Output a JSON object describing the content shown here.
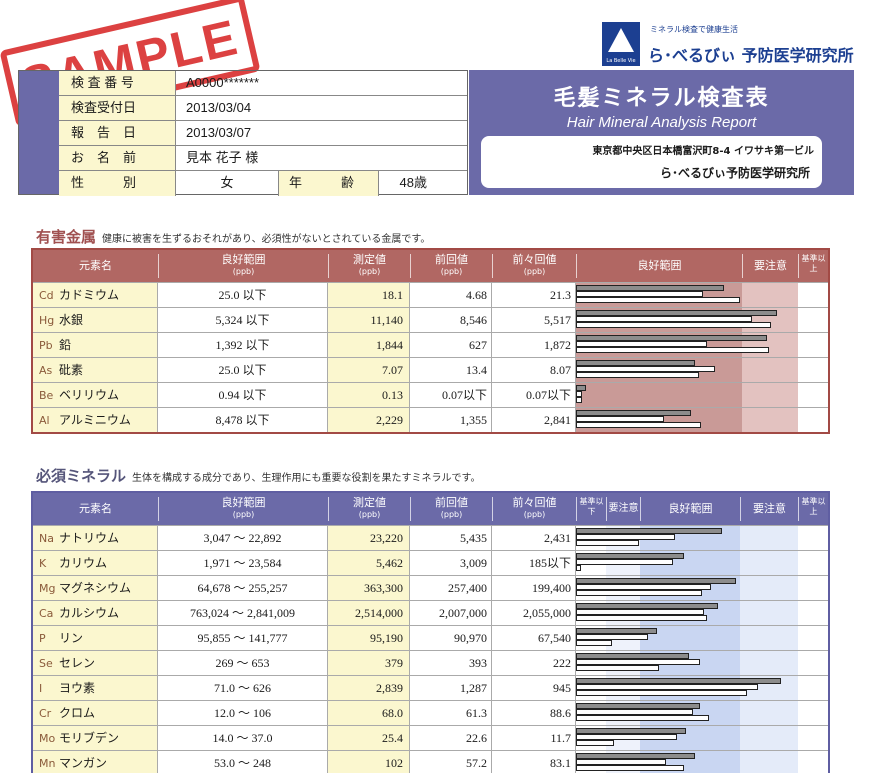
{
  "stamp": "SAMPLE",
  "logo": {
    "tagline": "ミネラル検査で健康生活",
    "name": "ら･べるびぃ 予防医学研究所",
    "mark": "La Belle Vie"
  },
  "info": {
    "id_label": "検 査 番 号",
    "id_value": "A0000*******",
    "received_label": "検査受付日",
    "received_value": "2013/03/04",
    "report_label": "報　告　日",
    "report_value": "2013/03/07",
    "name_label": "お　名　前",
    "name_value": "見本 花子 様",
    "sex_label": "性　　　別",
    "sex_value": "女",
    "age_label": "年　　　齢",
    "age_value": "48歳"
  },
  "title": {
    "jp": "毛髪ミネラル検査表",
    "en": "Hair Mineral Analysis Report",
    "address": "東京都中央区日本橋富沢町8-4 イワサキ第一ビル",
    "institute": "ら･べるびぃ予防医学研究所"
  },
  "harmful": {
    "title": "有害金属",
    "desc": "健康に被害を生ずるおそれがあり、必須性がないとされている金属です。",
    "headers": {
      "element": "元素名",
      "range": "良好範囲",
      "unit": "(ppb)",
      "measured": "測定値",
      "prev": "前回値",
      "prev2": "前々回値",
      "good": "良好範囲",
      "caution": "要注意",
      "above": "基準以上"
    },
    "rows": [
      {
        "sym": "Cd",
        "name": "カドミウム",
        "range": "25.0 以下",
        "measured": "18.1",
        "prev": "4.68",
        "prev2": "21.3",
        "bars": [
          0.72,
          0.62,
          0.8
        ]
      },
      {
        "sym": "Hg",
        "name": "水銀",
        "range": "5,324 以下",
        "measured": "11,140",
        "prev": "8,546",
        "prev2": "5,517",
        "bars": [
          0.98,
          0.86,
          0.95
        ]
      },
      {
        "sym": "Pb",
        "name": "鉛",
        "range": "1,392 以下",
        "measured": "1,844",
        "prev": "627",
        "prev2": "1,872",
        "bars": [
          0.93,
          0.64,
          0.94
        ]
      },
      {
        "sym": "As",
        "name": "砒素",
        "range": "25.0 以下",
        "measured": "7.07",
        "prev": "13.4",
        "prev2": "8.07",
        "bars": [
          0.58,
          0.68,
          0.6
        ]
      },
      {
        "sym": "Be",
        "name": "ベリリウム",
        "range": "0.94 以下",
        "measured": "0.13",
        "prev": "0.07以下",
        "prev2": "0.07以下",
        "bars": [
          0.05,
          0.03,
          0.03
        ]
      },
      {
        "sym": "Al",
        "name": "アルミニウム",
        "range": "8,478 以下",
        "measured": "2,229",
        "prev": "1,355",
        "prev2": "2,841",
        "bars": [
          0.56,
          0.43,
          0.61
        ]
      }
    ]
  },
  "essential": {
    "title": "必須ミネラル",
    "desc": "生体を構成する成分であり、生理作用にも重要な役割を果たすミネラルです。",
    "headers": {
      "element": "元素名",
      "range": "良好範囲",
      "unit": "(ppb)",
      "measured": "測定値",
      "prev": "前回値",
      "prev2": "前々回値",
      "below": "基準以下",
      "caution_low": "要注意",
      "good": "良好範囲",
      "caution_high": "要注意",
      "above": "基準以上"
    },
    "rows": [
      {
        "sym": "Na",
        "name": "ナトリウム",
        "range": "3,047 〜 22,892",
        "measured": "23,220",
        "prev": "5,435",
        "prev2": "2,431",
        "bars": [
          0.65,
          0.44,
          0.28
        ]
      },
      {
        "sym": "K",
        "name": "カリウム",
        "range": "1,971 〜 23,584",
        "measured": "5,462",
        "prev": "3,009",
        "prev2": "185以下",
        "bars": [
          0.48,
          0.43,
          0.02
        ]
      },
      {
        "sym": "Mg",
        "name": "マグネシウム",
        "range": "64,678 〜 255,257",
        "measured": "363,300",
        "prev": "257,400",
        "prev2": "199,400",
        "bars": [
          0.71,
          0.6,
          0.56
        ]
      },
      {
        "sym": "Ca",
        "name": "カルシウム",
        "range": "763,024 〜 2,841,009",
        "measured": "2,514,000",
        "prev": "2,007,000",
        "prev2": "2,055,000",
        "bars": [
          0.63,
          0.57,
          0.58
        ]
      },
      {
        "sym": "P",
        "name": "リン",
        "range": "95,855 〜 141,777",
        "measured": "95,190",
        "prev": "90,970",
        "prev2": "67,540",
        "bars": [
          0.36,
          0.32,
          0.16
        ]
      },
      {
        "sym": "Se",
        "name": "セレン",
        "range": "269 〜 653",
        "measured": "379",
        "prev": "393",
        "prev2": "222",
        "bars": [
          0.5,
          0.55,
          0.37
        ]
      },
      {
        "sym": "I",
        "name": "ヨウ素",
        "range": "71.0 〜 626",
        "measured": "2,839",
        "prev": "1,287",
        "prev2": "945",
        "bars": [
          0.91,
          0.81,
          0.76
        ]
      },
      {
        "sym": "Cr",
        "name": "クロム",
        "range": "12.0 〜 106",
        "measured": "68.0",
        "prev": "61.3",
        "prev2": "88.6",
        "bars": [
          0.55,
          0.52,
          0.59
        ]
      },
      {
        "sym": "Mo",
        "name": "モリブデン",
        "range": "14.0 〜 37.0",
        "measured": "25.4",
        "prev": "22.6",
        "prev2": "11.7",
        "bars": [
          0.49,
          0.45,
          0.17
        ]
      },
      {
        "sym": "Mn",
        "name": "マンガン",
        "range": "53.0 〜 248",
        "measured": "102",
        "prev": "57.2",
        "prev2": "83.1",
        "bars": [
          0.53,
          0.4,
          0.48
        ]
      }
    ]
  },
  "colors": {
    "harmful_header": "#b16763",
    "essential_header": "#6b6aa8",
    "label_bg": "#fbf7cf",
    "stamp": "#d62020"
  }
}
